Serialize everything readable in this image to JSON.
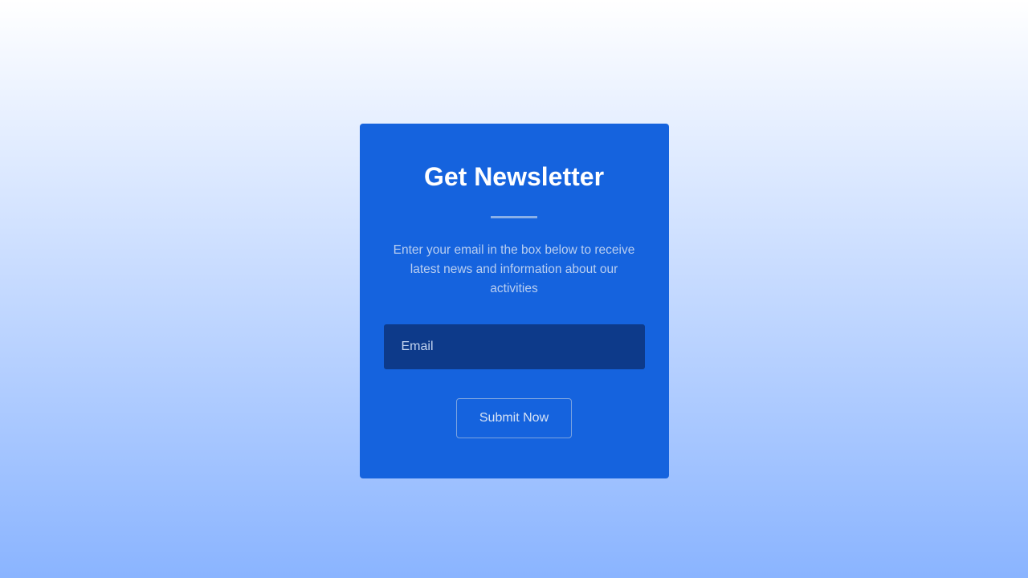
{
  "card": {
    "title": "Get Newsletter",
    "description": "Enter your email in the box below to receive latest news and information about our activities",
    "emailPlaceholder": "Email",
    "submitLabel": "Submit Now"
  }
}
